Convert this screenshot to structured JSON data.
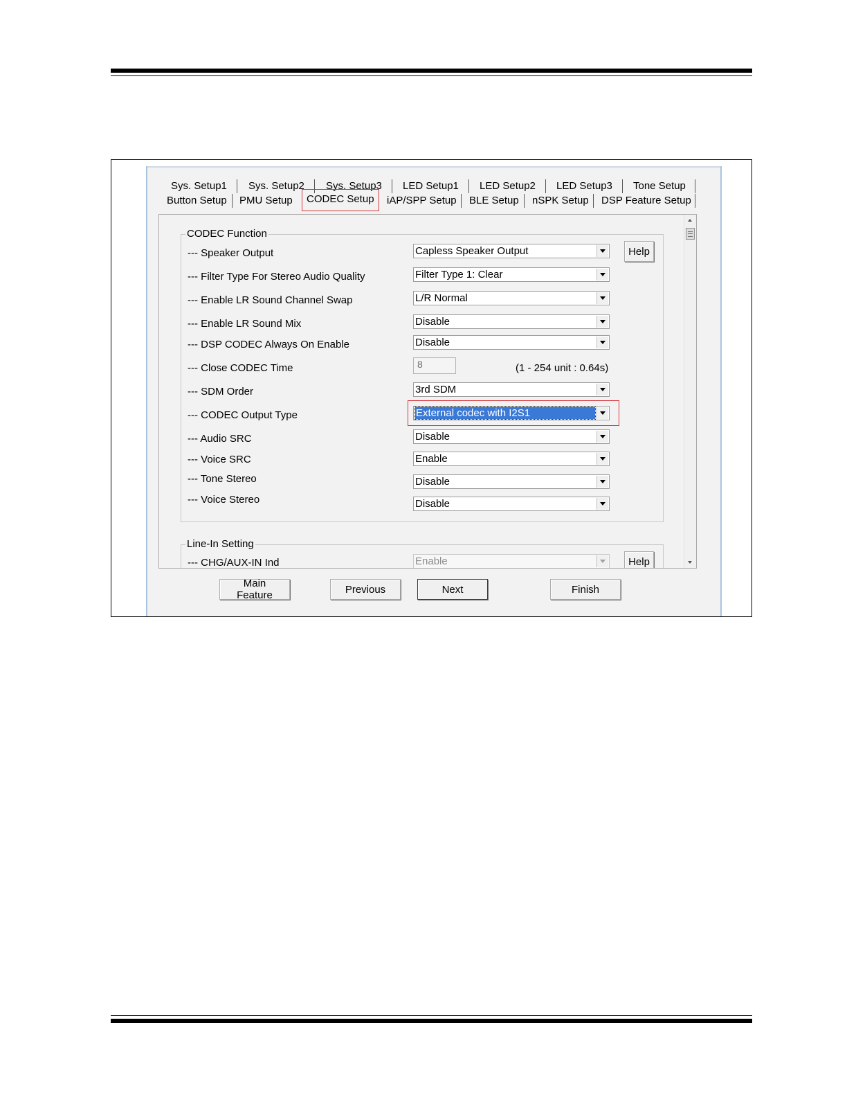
{
  "tabs_row1": [
    "Sys. Setup1",
    "Sys. Setup2",
    "Sys. Setup3",
    "LED Setup1",
    "LED Setup2",
    "LED Setup3",
    "Tone Setup"
  ],
  "tabs_row2": [
    "Button Setup",
    "PMU Setup",
    "CODEC Setup",
    "iAP/SPP Setup",
    "BLE Setup",
    "nSPK Setup",
    "DSP Feature Setup"
  ],
  "active_tab": "CODEC Setup",
  "codec_function": {
    "title": "CODEC Function",
    "help_label": "Help",
    "rows": [
      {
        "label": "--- Speaker Output",
        "value": "Capless Speaker Output"
      },
      {
        "label": "--- Filter Type For Stereo Audio Quality",
        "value": "Filter Type 1: Clear"
      },
      {
        "label": "--- Enable LR Sound Channel Swap",
        "value": "L/R Normal"
      },
      {
        "label": "--- Enable LR Sound Mix",
        "value": "Disable"
      },
      {
        "label": "--- DSP CODEC Always On Enable",
        "value": "Disable"
      },
      {
        "label": "--- Close CODEC Time",
        "value": "8",
        "note": "(1 - 254 unit : 0.64s)"
      },
      {
        "label": "--- SDM Order",
        "value": "3rd SDM"
      },
      {
        "label": "--- CODEC Output Type",
        "value": "External codec with I2S1"
      },
      {
        "label": "--- Audio SRC",
        "value": "Disable"
      },
      {
        "label": "--- Voice SRC",
        "value": "Enable"
      },
      {
        "label": "--- Tone Stereo",
        "value": "Disable"
      },
      {
        "label": "--- Voice Stereo",
        "value": "Disable"
      }
    ]
  },
  "line_in": {
    "title": "Line-In Setting",
    "help_label": "Help",
    "rows": [
      {
        "label": "--- CHG/AUX-IN Ind",
        "value": "Enable"
      }
    ]
  },
  "buttons": {
    "main_feature": "Main Feature",
    "previous": "Previous",
    "next": "Next",
    "finish": "Finish"
  }
}
